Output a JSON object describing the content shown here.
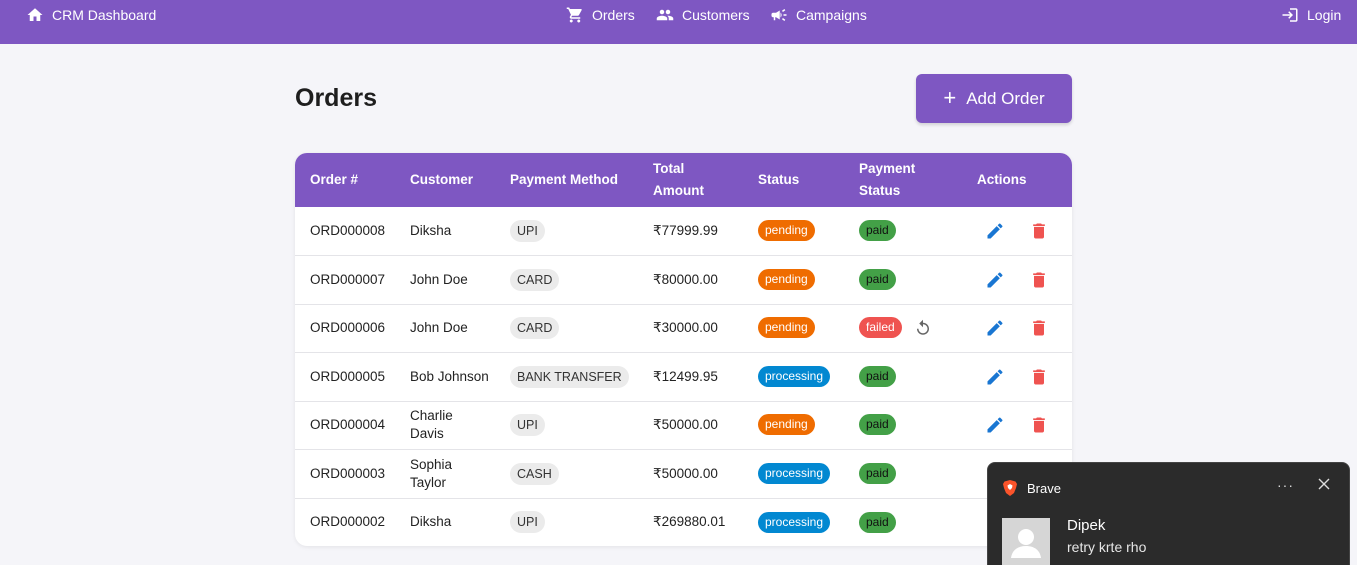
{
  "nav": {
    "brand": "CRM Dashboard",
    "orders": "Orders",
    "customers": "Customers",
    "campaigns": "Campaigns",
    "login": "Login"
  },
  "page": {
    "title": "Orders",
    "add_button": "Add Order"
  },
  "table": {
    "headers": {
      "order": "Order #",
      "customer": "Customer",
      "payment_method": "Payment Method",
      "total_amount_1": "Total",
      "total_amount_2": "Amount",
      "status": "Status",
      "payment_status_1": "Payment",
      "payment_status_2": "Status",
      "actions": "Actions"
    },
    "rows": [
      {
        "order": "ORD000008",
        "customer": "Diksha",
        "method": "UPI",
        "amount": "₹77999.99",
        "status": "pending",
        "payment_status": "paid"
      },
      {
        "order": "ORD000007",
        "customer": "John Doe",
        "method": "CARD",
        "amount": "₹80000.00",
        "status": "pending",
        "payment_status": "paid"
      },
      {
        "order": "ORD000006",
        "customer": "John Doe",
        "method": "CARD",
        "amount": "₹30000.00",
        "status": "pending",
        "payment_status": "failed"
      },
      {
        "order": "ORD000005",
        "customer": "Bob Johnson",
        "method": "BANK TRANSFER",
        "amount": "₹12499.95",
        "status": "processing",
        "payment_status": "paid"
      },
      {
        "order": "ORD000004",
        "customer": "Charlie Davis",
        "method": "UPI",
        "amount": "₹50000.00",
        "status": "pending",
        "payment_status": "paid"
      },
      {
        "order": "ORD000003",
        "customer": "Sophia Taylor",
        "method": "CASH",
        "amount": "₹50000.00",
        "status": "processing",
        "payment_status": "paid"
      },
      {
        "order": "ORD000002",
        "customer": "Diksha",
        "method": "UPI",
        "amount": "₹269880.01",
        "status": "processing",
        "payment_status": "paid"
      }
    ]
  },
  "colors": {
    "accent": "#7e57c2",
    "pending": "#ef6c00",
    "processing": "#0288d1",
    "paid": "#43a047",
    "failed": "#ef5350",
    "edit": "#1976d2",
    "delete": "#ef5350"
  },
  "icons": {
    "brand": "home-icon",
    "orders": "cart-icon",
    "customers": "people-icon",
    "campaigns": "megaphone-icon",
    "login": "login-icon",
    "add": "plus-icon",
    "edit": "pencil-icon",
    "delete": "trash-icon",
    "retry": "retry-icon"
  },
  "toast": {
    "app": "Brave",
    "more": "···",
    "sender": "Dipek",
    "message": "retry krte rho"
  }
}
